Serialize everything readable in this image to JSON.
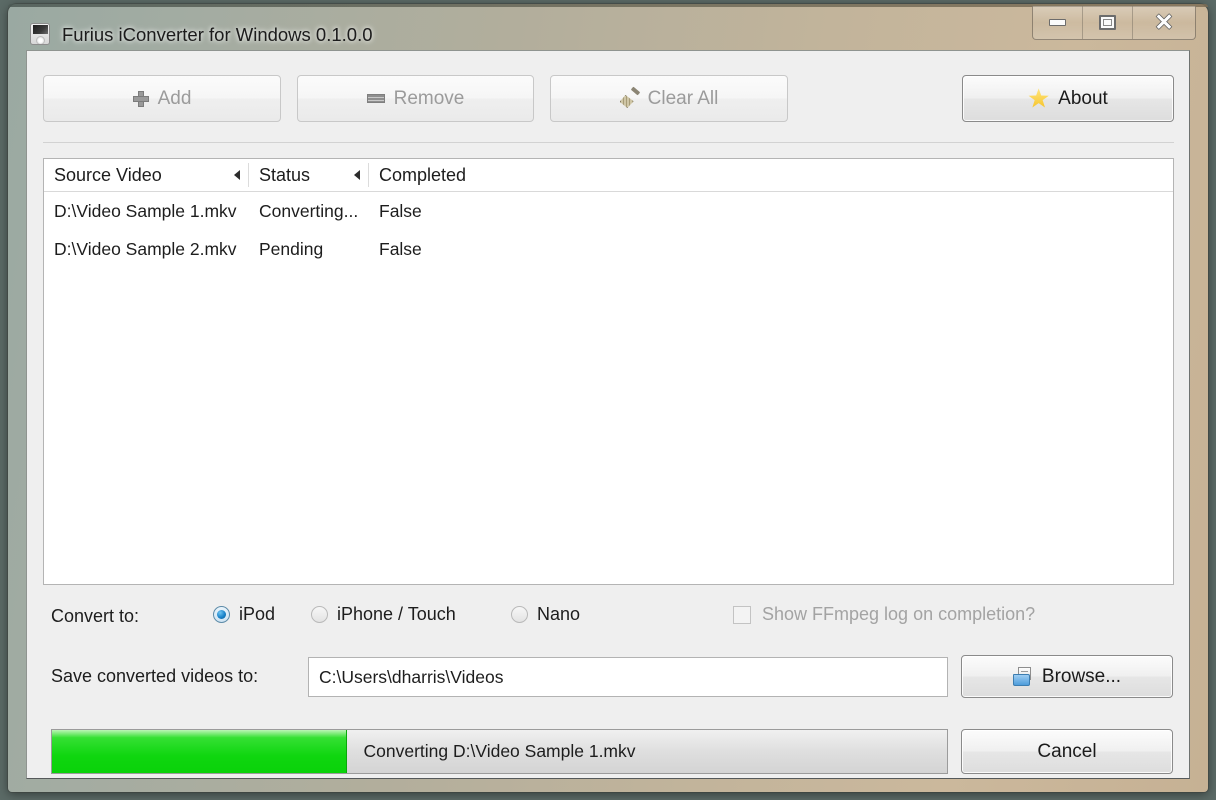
{
  "window": {
    "title": "Furius iConverter for Windows 0.1.0.0",
    "app_icon": "ipod-icon",
    "controls": {
      "minimize": "minimize-icon",
      "maximize": "maximize-icon",
      "close": "close-icon",
      "close_glyph": "✕"
    }
  },
  "toolbar": {
    "buttons": [
      {
        "label": "Add",
        "icon": "plus-icon",
        "enabled": false
      },
      {
        "label": "Remove",
        "icon": "dash-icon",
        "enabled": false
      },
      {
        "label": "Clear All",
        "icon": "broom-icon",
        "enabled": false
      },
      {
        "label": "About",
        "icon": "star-icon",
        "enabled": true
      }
    ]
  },
  "list": {
    "columns": [
      "Source Video",
      "Status",
      "Completed"
    ],
    "rows": [
      {
        "source": "D:\\Video Sample 1.mkv",
        "status": "Converting...",
        "completed": "False"
      },
      {
        "source": "D:\\Video Sample 2.mkv",
        "status": "Pending",
        "completed": "False"
      }
    ]
  },
  "options": {
    "convert_label": "Convert to:",
    "formats": [
      {
        "label": "iPod",
        "selected": true
      },
      {
        "label": "iPhone / Touch",
        "selected": false
      },
      {
        "label": "Nano",
        "selected": false
      }
    ],
    "ffmpeg_log": {
      "label": "Show FFmpeg log on completion?",
      "checked": false,
      "enabled": false
    }
  },
  "save": {
    "label": "Save converted videos to:",
    "path_value": "C:\\Users\\dharris\\Videos",
    "browse_label": "Browse...",
    "browse_icon": "folder-icon"
  },
  "progress": {
    "text": "Converting D:\\Video Sample 1.mkv",
    "percent": 33,
    "fill_color": "#0fd60f",
    "cancel_label": "Cancel"
  }
}
